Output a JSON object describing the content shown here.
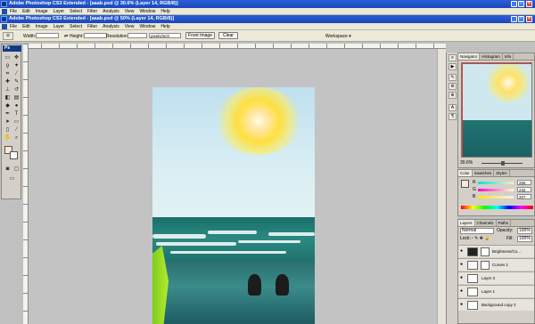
{
  "outer_window": {
    "title": "Adobe Photoshop CS3 Extended - [aaab.psd @ 30.6% (Layer 14, RGB/8)]"
  },
  "inner_window": {
    "title": "Adobe Photoshop CS3 Extended - [aaab.psd @ 50% (Layer 14, RGB/8)]"
  },
  "menu": [
    "File",
    "Edit",
    "Image",
    "Layer",
    "Select",
    "Filter",
    "Analysis",
    "View",
    "Window",
    "Help"
  ],
  "options": {
    "width_label": "Width:",
    "height_label": "Height:",
    "resolution_label": "Resolution:",
    "unit": "pixels/inch",
    "front_image": "Front Image",
    "clear": "Clear",
    "workspace": "Workspace ▾"
  },
  "toolbox": {
    "header": "Ps"
  },
  "navigator": {
    "tabs": [
      "Navigator",
      "Histogram",
      "Info"
    ],
    "zoom": "30.6%"
  },
  "color": {
    "tabs": [
      "Color",
      "Swatches",
      "Styles"
    ],
    "r_label": "R",
    "r_value": "255",
    "g_label": "G",
    "g_value": "232",
    "b_label": "B",
    "b_value": "207"
  },
  "layers": {
    "tabs": [
      "Layers",
      "Channels",
      "Paths"
    ],
    "blend_mode": "Normal",
    "opacity_label": "Opacity:",
    "opacity": "100%",
    "lock_label": "Lock:",
    "fill_label": "Fill:",
    "fill": "100%",
    "items": [
      "Brightness/Co...",
      "Curves 1",
      "Layer 3",
      "Layer 1",
      "Background copy 2"
    ]
  },
  "colors": {
    "title_bar": "#2a5fd8",
    "fg_swatch": "#fde6d5"
  }
}
